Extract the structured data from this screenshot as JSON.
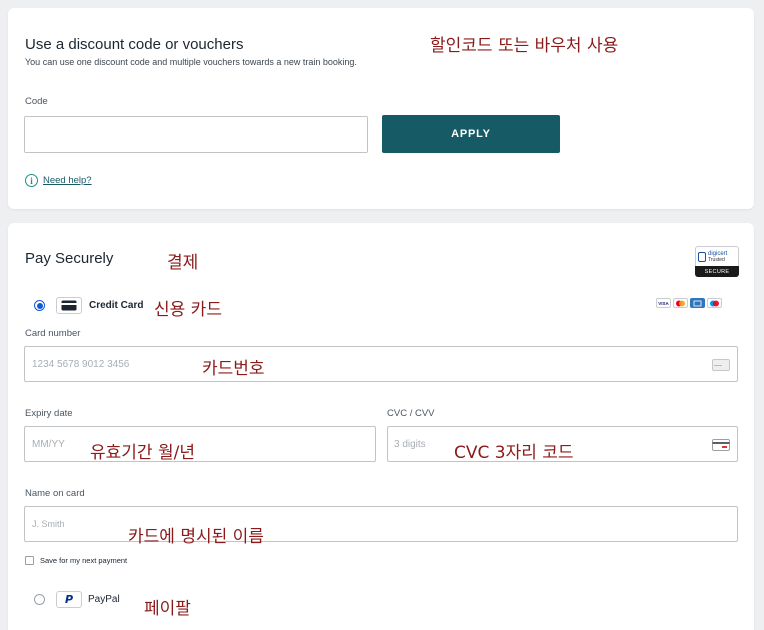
{
  "discount": {
    "title": "Use a discount code or vouchers",
    "subtitle": "You can use one discount code and multiple vouchers towards a new train booking.",
    "annotation": "할인코드 또는 바우처 사용",
    "code_label": "Code",
    "code_value": "",
    "apply_label": "APPLY",
    "help_label": "Need help?",
    "info_glyph": "i"
  },
  "payment": {
    "title": "Pay Securely",
    "annotation": "결제",
    "badge": {
      "line1": "digicert",
      "line2": "Trusted",
      "line3": "SECURE"
    },
    "credit_card": {
      "label": "Credit Card",
      "annotation": "신용 카드",
      "selected": true,
      "brands": [
        {
          "name": "VISA",
          "color": "#1a1f71"
        },
        {
          "name": "MC",
          "color": "#eb001b"
        },
        {
          "name": "AMEX",
          "color": "#2e77bc"
        },
        {
          "name": "Maestro",
          "color": "#0099df"
        }
      ]
    },
    "card_number": {
      "label": "Card number",
      "placeholder": "1234 5678 9012 3456",
      "annotation": "카드번호"
    },
    "expiry": {
      "label": "Expiry date",
      "placeholder": "MM/YY",
      "annotation": "유효기간 월/년"
    },
    "cvc": {
      "label": "CVC / CVV",
      "placeholder": "3 digits",
      "annotation": "CVC 3자리 코드"
    },
    "name": {
      "label": "Name on card",
      "placeholder": "J. Smith",
      "annotation": "카드에 명시된 이름"
    },
    "save_label": "Save for my next payment",
    "paypal": {
      "label": "PayPal",
      "annotation": "페이팔",
      "selected": false,
      "glyph": "P"
    }
  }
}
